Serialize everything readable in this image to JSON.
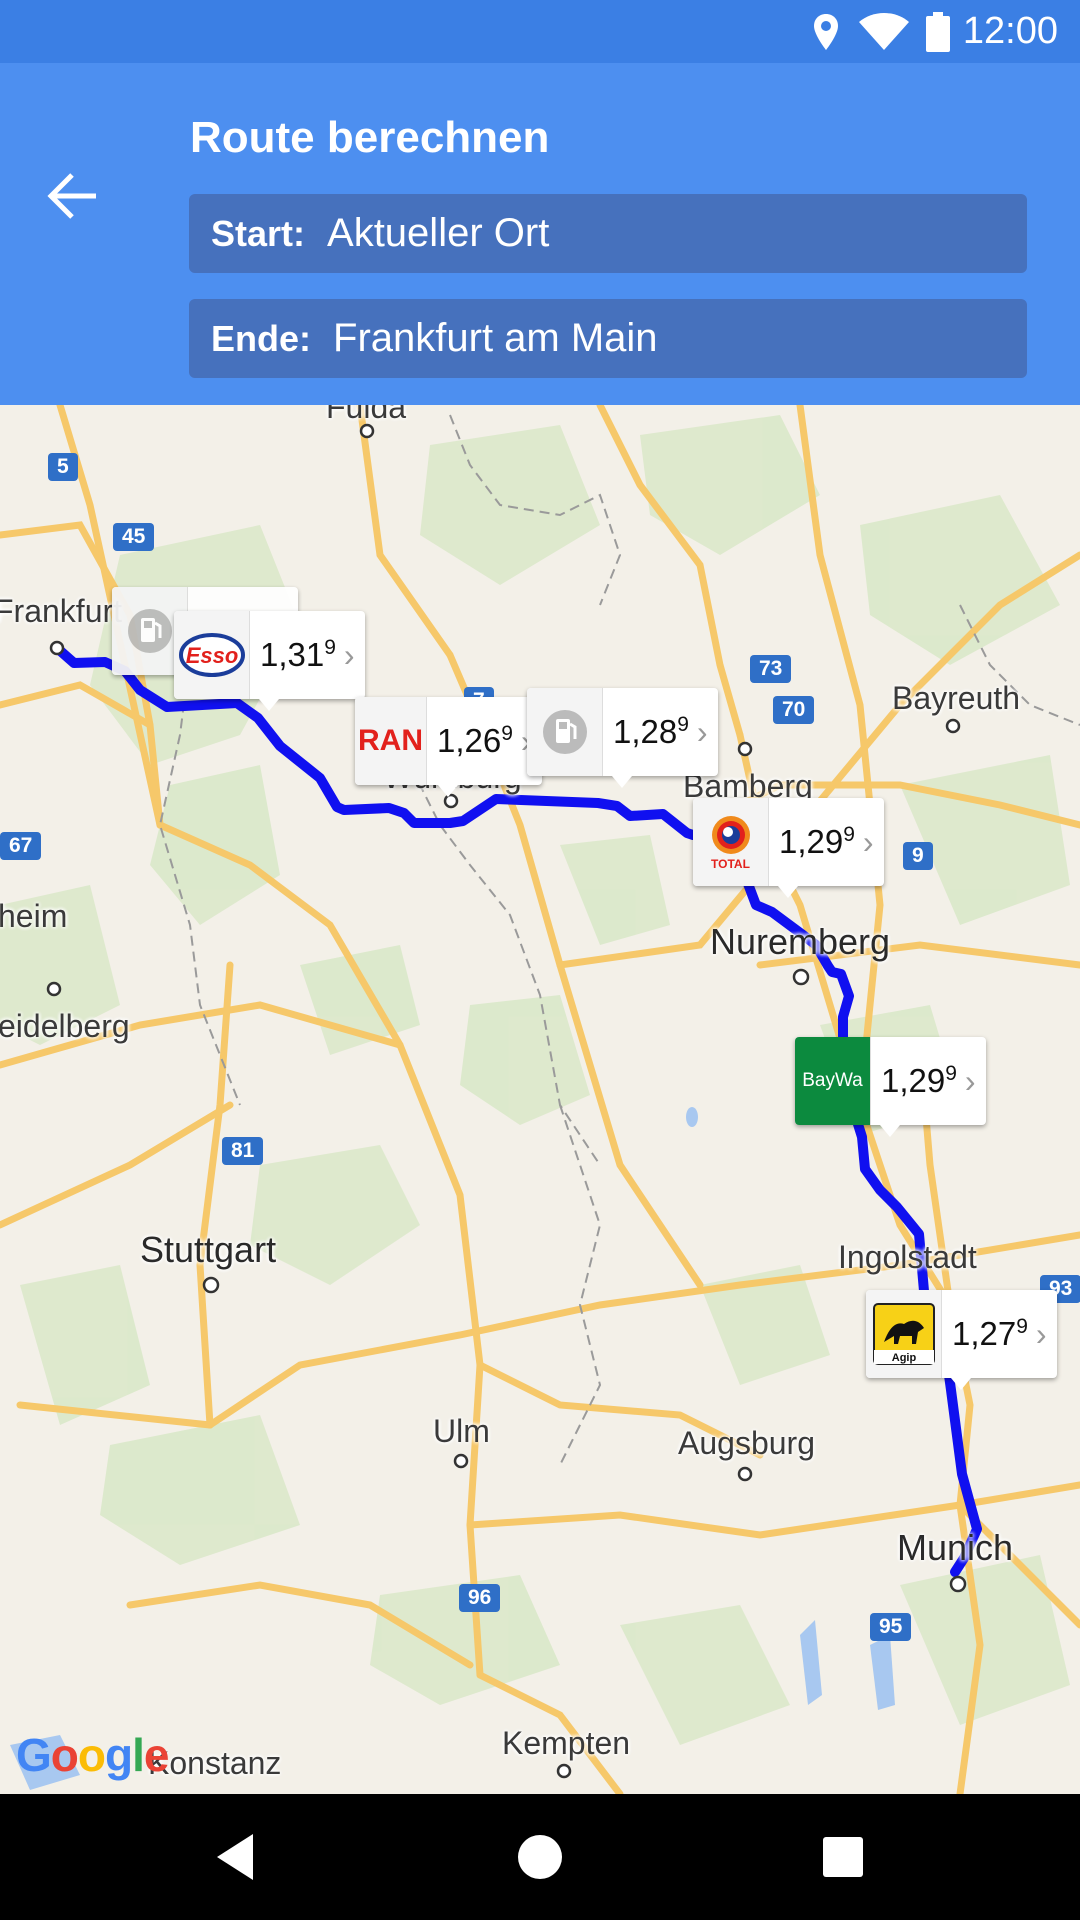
{
  "status_bar": {
    "time": "12:00"
  },
  "header": {
    "title": "Route berechnen",
    "start_label": "Start:",
    "start_value": "Aktueller Ort",
    "end_label": "Ende:",
    "end_value": "Frankfurt am Main"
  },
  "map": {
    "cities": {
      "fulda": "Fulda",
      "frankfurt": "Frankfurt",
      "wurzburg": "Würzburg",
      "bamberg": "Bamberg",
      "bayreuth": "Bayreuth",
      "nuremberg": "Nuremberg",
      "mannheim": "heim",
      "heidelberg": "eidelberg",
      "stuttgart": "Stuttgart",
      "ingolstadt": "Ingolstadt",
      "ulm": "Ulm",
      "augsburg": "Augsburg",
      "munich": "Munich",
      "kempten": "Kempten",
      "konstanz": "Konstanz"
    },
    "roads": {
      "r5": "5",
      "r45": "45",
      "r7": "7",
      "r73": "73",
      "r70": "70",
      "r67": "67",
      "r9": "9",
      "r81": "81",
      "r93": "93",
      "r96": "96",
      "r95": "95"
    },
    "markers": [
      {
        "brand": "Esso",
        "price": "1,31",
        "decimal": "9"
      },
      {
        "brand": "RAN",
        "price": "1,26",
        "decimal": "9"
      },
      {
        "brand": "generic",
        "price": "1,28",
        "decimal": "9"
      },
      {
        "brand": "Total",
        "brand_text": "TOTAL",
        "price": "1,29",
        "decimal": "9"
      },
      {
        "brand": "BayWa",
        "price": "1,29",
        "decimal": "9"
      },
      {
        "brand": "Agip",
        "price": "1,27",
        "decimal": "9"
      }
    ],
    "google_logo": "Google",
    "route_color": "#1010f0"
  },
  "colors": {
    "status_bar": "#3b7fe4",
    "app_bar": "#4d8ff0",
    "field_bg": "#4671bd"
  }
}
